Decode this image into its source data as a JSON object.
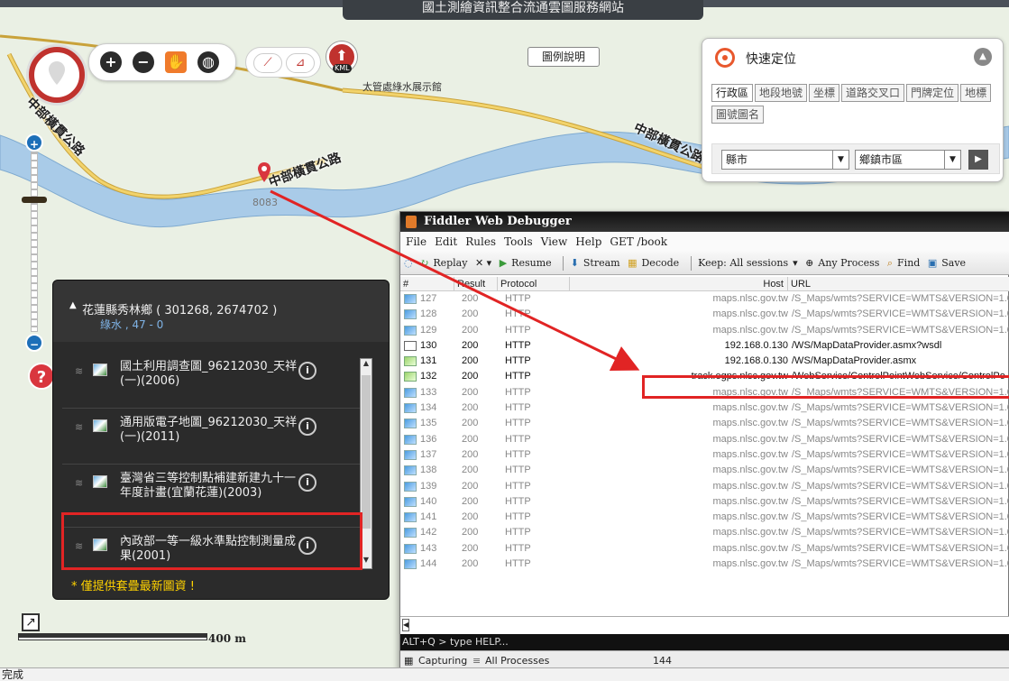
{
  "banner": {
    "title": "國土測繪資訊整合流通雲圖服務網站"
  },
  "toolbar": {
    "kml_label": "KML"
  },
  "legend_button": "圖例說明",
  "map": {
    "place_label": "太管處綠水展示館",
    "road_label_1": "中部橫貫公路",
    "road_label_2": "中部橫貫公路",
    "road_label_3": "中部橫貫公路",
    "pin_number": "8083"
  },
  "quick_locate": {
    "title": "快速定位",
    "tabs": [
      "行政區",
      "地段地號",
      "坐標",
      "道路交叉口",
      "門牌定位",
      "地標",
      "圖號圖名"
    ],
    "county_select": "縣市",
    "town_select": "鄉鎮市區"
  },
  "layers": {
    "location_title": "花蓮縣秀林鄉 ( 301268, 2674702 )",
    "location_sub": "綠水 , 47 - 0",
    "items": [
      {
        "name": "國土利用調查圖_96212030_天祥(一)(2006)"
      },
      {
        "name": "通用版電子地圖_96212030_天祥(一)(2011)"
      },
      {
        "name": "臺灣省三等控制點補建新建九十一年度計畫(宜蘭花蓮)(2003)"
      },
      {
        "name": "內政部一等一級水準點控制測量成果(2001)"
      }
    ],
    "note": "* 僅提供套疊最新圖資 !"
  },
  "scale": {
    "label": "400 m"
  },
  "browser_status": "完成",
  "fiddler": {
    "title": "Fiddler Web Debugger",
    "menu": [
      "File",
      "Edit",
      "Rules",
      "Tools",
      "View",
      "Help",
      "GET /book"
    ],
    "tools": [
      "Replay",
      "Resume",
      "Stream",
      "Decode",
      "Keep: All sessions",
      "Any Process",
      "Find",
      "Save"
    ],
    "columns": [
      "#",
      "Result",
      "Protocol",
      "Host",
      "URL"
    ],
    "rows": [
      {
        "num": "127",
        "result": "200",
        "protocol": "HTTP",
        "host": "maps.nlsc.gov.tw",
        "url": "/S_Maps/wmts?SERVICE=WMTS&VERSION=1.0",
        "icon": "img",
        "dark": false
      },
      {
        "num": "128",
        "result": "200",
        "protocol": "HTTP",
        "host": "maps.nlsc.gov.tw",
        "url": "/S_Maps/wmts?SERVICE=WMTS&VERSION=1.0",
        "icon": "img",
        "dark": false
      },
      {
        "num": "129",
        "result": "200",
        "protocol": "HTTP",
        "host": "maps.nlsc.gov.tw",
        "url": "/S_Maps/wmts?SERVICE=WMTS&VERSION=1.0",
        "icon": "img",
        "dark": false
      },
      {
        "num": "130",
        "result": "200",
        "protocol": "HTTP",
        "host": "192.168.0.130",
        "url": "/WS/MapDataProvider.asmx?wsdl",
        "icon": "ws",
        "dark": true
      },
      {
        "num": "131",
        "result": "200",
        "protocol": "HTTP",
        "host": "192.168.0.130",
        "url": "/WS/MapDataProvider.asmx",
        "icon": "ar",
        "dark": true
      },
      {
        "num": "132",
        "result": "200",
        "protocol": "HTTP",
        "host": "track.egps.nlsc.gov.tw",
        "url": "/WebService/ControlPointWebService/ControlPo",
        "icon": "ar",
        "dark": true
      },
      {
        "num": "133",
        "result": "200",
        "protocol": "HTTP",
        "host": "maps.nlsc.gov.tw",
        "url": "/S_Maps/wmts?SERVICE=WMTS&VERSION=1.0",
        "icon": "img",
        "dark": false
      },
      {
        "num": "134",
        "result": "200",
        "protocol": "HTTP",
        "host": "maps.nlsc.gov.tw",
        "url": "/S_Maps/wmts?SERVICE=WMTS&VERSION=1.0",
        "icon": "img",
        "dark": false
      },
      {
        "num": "135",
        "result": "200",
        "protocol": "HTTP",
        "host": "maps.nlsc.gov.tw",
        "url": "/S_Maps/wmts?SERVICE=WMTS&VERSION=1.0",
        "icon": "img",
        "dark": false
      },
      {
        "num": "136",
        "result": "200",
        "protocol": "HTTP",
        "host": "maps.nlsc.gov.tw",
        "url": "/S_Maps/wmts?SERVICE=WMTS&VERSION=1.0",
        "icon": "img",
        "dark": false
      },
      {
        "num": "137",
        "result": "200",
        "protocol": "HTTP",
        "host": "maps.nlsc.gov.tw",
        "url": "/S_Maps/wmts?SERVICE=WMTS&VERSION=1.0",
        "icon": "img",
        "dark": false
      },
      {
        "num": "138",
        "result": "200",
        "protocol": "HTTP",
        "host": "maps.nlsc.gov.tw",
        "url": "/S_Maps/wmts?SERVICE=WMTS&VERSION=1.0",
        "icon": "img",
        "dark": false
      },
      {
        "num": "139",
        "result": "200",
        "protocol": "HTTP",
        "host": "maps.nlsc.gov.tw",
        "url": "/S_Maps/wmts?SERVICE=WMTS&VERSION=1.0",
        "icon": "img",
        "dark": false
      },
      {
        "num": "140",
        "result": "200",
        "protocol": "HTTP",
        "host": "maps.nlsc.gov.tw",
        "url": "/S_Maps/wmts?SERVICE=WMTS&VERSION=1.0",
        "icon": "img",
        "dark": false
      },
      {
        "num": "141",
        "result": "200",
        "protocol": "HTTP",
        "host": "maps.nlsc.gov.tw",
        "url": "/S_Maps/wmts?SERVICE=WMTS&VERSION=1.0",
        "icon": "img",
        "dark": false
      },
      {
        "num": "142",
        "result": "200",
        "protocol": "HTTP",
        "host": "maps.nlsc.gov.tw",
        "url": "/S_Maps/wmts?SERVICE=WMTS&VERSION=1.0",
        "icon": "img",
        "dark": false
      },
      {
        "num": "143",
        "result": "200",
        "protocol": "HTTP",
        "host": "maps.nlsc.gov.tw",
        "url": "/S_Maps/wmts?SERVICE=WMTS&VERSION=1.0",
        "icon": "img",
        "dark": false
      },
      {
        "num": "144",
        "result": "200",
        "protocol": "HTTP",
        "host": "maps.nlsc.gov.tw",
        "url": "/S_Maps/wmts?SERVICE=WMTS&VERSION=1.0",
        "icon": "img",
        "dark": false
      }
    ],
    "quickexec": "ALT+Q > type HELP...",
    "status_capturing": "Capturing",
    "status_processes": "All Processes",
    "status_count": "144"
  },
  "colors": {
    "highlight": "#e12424",
    "river": "#a9cbe8",
    "road": "#f2c94c"
  }
}
